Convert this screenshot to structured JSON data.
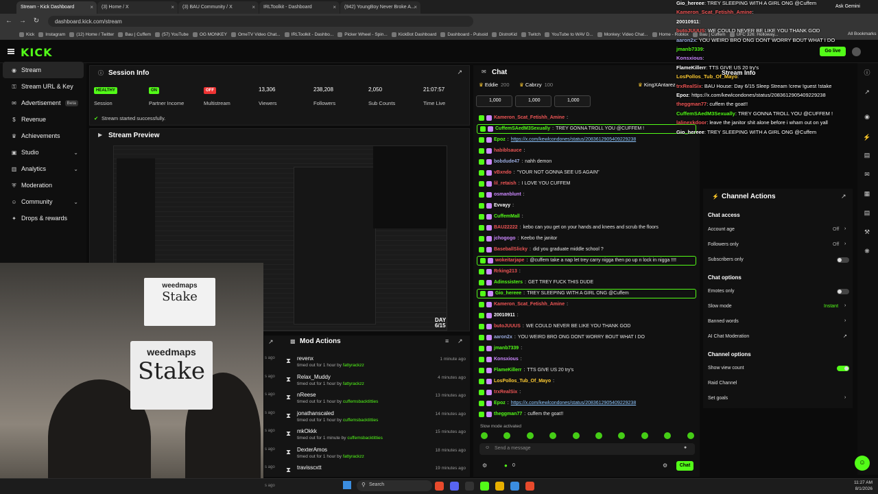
{
  "browser": {
    "tabs": [
      {
        "label": "Stream - Kick Dashboard",
        "active": true
      },
      {
        "label": "(3) Home / X"
      },
      {
        "label": "(3) BAU Community / X"
      },
      {
        "label": "IRLToolkit - Dashboard"
      },
      {
        "label": "(942) YoungBoy Never Broke A..."
      }
    ],
    "url": "dashboard.kick.com/stream",
    "ask_gemini": "Ask Gemini",
    "all_bookmarks": "All Bookmarks",
    "bookmarks": [
      "Kick",
      "Instagram",
      "(12) Home / Twitter",
      "Bau | Cuffem",
      "(57) YouTube",
      "OG MONKEY",
      "OmeTV Video Chat...",
      "IRLToolkit - Dashbo...",
      "Picker Wheel - Spin...",
      "KickBot Dashboard",
      "Dashboard - Pulsoid",
      "DistroKid",
      "Twitch",
      "YouTube to WAV D...",
      "Monkey: Video Chat...",
      "Home - Roblox",
      "Bau | Cuffem",
      "UFC 326: Holloway..."
    ]
  },
  "kick": {
    "logo": "KICK",
    "go_live": "Go live",
    "sidebar": [
      {
        "label": "Stream",
        "icon": "broadcast-icon",
        "active": true
      },
      {
        "label": "Stream URL & Key",
        "icon": "key-icon"
      },
      {
        "label": "Advertisement",
        "icon": "megaphone-icon",
        "badge": "Beta"
      },
      {
        "label": "Revenue",
        "icon": "dollar-icon"
      },
      {
        "label": "Achievements",
        "icon": "trophy-icon"
      },
      {
        "label": "Studio",
        "icon": "studio-icon",
        "chevron": true
      },
      {
        "label": "Analytics",
        "icon": "chart-icon",
        "chevron": true
      },
      {
        "label": "Moderation",
        "icon": "shield-icon"
      },
      {
        "label": "Community",
        "icon": "people-icon",
        "chevron": true
      },
      {
        "label": "Drops & rewards",
        "icon": "gift-icon"
      }
    ],
    "session": {
      "title": "Session Info",
      "status": "Stream started successfully.",
      "stats": [
        {
          "value": "HEALTHY",
          "label": "Session",
          "badge_color": "#53fc18"
        },
        {
          "value": "ON",
          "label": "Partner Income",
          "badge_color": "#53fc18"
        },
        {
          "value": "OFF",
          "label": "Multistream",
          "badge_color": "#e33"
        },
        {
          "value": "13,306",
          "label": "Viewers"
        },
        {
          "value": "238,208",
          "label": "Followers"
        },
        {
          "value": "2,050",
          "label": "Sub Counts"
        },
        {
          "value": "21:07:57",
          "label": "Time Live"
        }
      ]
    },
    "preview": {
      "title": "Stream Preview",
      "banner_top": "weedmaps",
      "banner_bottom": "Stake",
      "day_label": "DAY 6/15",
      "wm_small": "weedmaps",
      "stake_small": "Stake"
    },
    "mod_actions": {
      "title": "Mod Actions",
      "side_times": [
        "s ago",
        "s ago",
        "s ago",
        "s ago",
        "s ago",
        "s ago",
        "s ago",
        "s ago"
      ],
      "items": [
        {
          "name": "revenx",
          "desc": "timed out for 1 hour by",
          "by": "fattyrackzz",
          "time": "1 minute ago"
        },
        {
          "name": "Relax_Muddy",
          "desc": "timed out for 1 hour by",
          "by": "fattyrackzz",
          "time": "4 minutes ago"
        },
        {
          "name": "nReese",
          "desc": "timed out for 1 hour by",
          "by": "cuffemsbacktitties",
          "time": "13 minutes ago"
        },
        {
          "name": "jonathanscaled",
          "desc": "timed out for 1 hour by",
          "by": "cuffemsbacktitties",
          "time": "14 minutes ago"
        },
        {
          "name": "mkOkkk",
          "desc": "timed out for 1 minute by",
          "by": "cuffemsbacktitties",
          "time": "15 minutes ago"
        },
        {
          "name": "DexterAmos",
          "desc": "timed out for 1 hour by",
          "by": "fattyrackzz",
          "time": "18 minutes ago"
        },
        {
          "name": "travisscxtt",
          "desc": "",
          "by": "",
          "time": "19 minutes ago"
        }
      ]
    },
    "chat": {
      "title": "Chat",
      "pinned": [
        {
          "name": "Eddie",
          "val": "200"
        },
        {
          "name": "Cabrzy",
          "val": "100"
        },
        {
          "name": "KingXAntarez",
          "val": ""
        }
      ],
      "gifts": [
        "1,000",
        "1,000",
        "1,000"
      ],
      "messages": [
        {
          "user": "Kameron_Scat_Fetishh_Amine",
          "text": "",
          "color": "#e55"
        },
        {
          "user": "CuffemSAedM3Sexually",
          "text": "TREY GONNA TROLL YOU @CUFFEM !",
          "color": "#53fc18",
          "hl": true
        },
        {
          "user": "Epoz",
          "text": "https://x.com/kewlcondones/status/2083612905409229238",
          "color": "#53fc18",
          "link": true
        },
        {
          "user": "habiblsauce",
          "text": "",
          "color": "#e55"
        },
        {
          "user": "bobdude47",
          "text": "nahh demon",
          "color": "#9ad"
        },
        {
          "user": "vBxndo",
          "text": "\"YOUR NOT GONNA SEE US AGAIN\"",
          "color": "#e55"
        },
        {
          "user": "lil_retaish",
          "text": "I LOVE YOU CUFFEM",
          "color": "#e55"
        },
        {
          "user": "osmanblunt",
          "text": "",
          "color": "#c8f"
        },
        {
          "user": "Evvayy",
          "text": "",
          "color": "#fff"
        },
        {
          "user": "CuffemMall",
          "text": "",
          "color": "#53fc18"
        },
        {
          "user": "BAU22222",
          "text": "kebo can you get on your hands and knees and scrub the floors",
          "color": "#e55"
        },
        {
          "user": "jchogogo",
          "text": "Keebo the janitor",
          "color": "#c8f"
        },
        {
          "user": "BaseballSlicky",
          "text": "did you graduate middle school ?",
          "color": "#e55"
        },
        {
          "user": "wokeitarjape",
          "text": "@cuffem take a nap let trey carry nigga then po up n lock in nigga !!!!",
          "color": "#e55",
          "hl": true
        },
        {
          "user": "Rrking213",
          "text": "",
          "color": "#e55"
        },
        {
          "user": "Adinssisters",
          "text": "GET TREY FUCK THIS DUDE",
          "color": "#53fc18"
        },
        {
          "user": "Gio_hereee",
          "text": "TREY SLEEPING WITH A GIRL ONG @Cuffem",
          "color": "#53fc18",
          "hl": true
        },
        {
          "user": "Kameron_Scat_Fetishh_Amine",
          "text": "",
          "color": "#e55"
        },
        {
          "user": "20010911",
          "text": "",
          "color": "#fff"
        },
        {
          "user": "butoJUUUS",
          "text": "WE COULD NEVER BE LIKE YOU THANK GOD",
          "color": "#e55"
        },
        {
          "user": "aaron2x",
          "text": "YOU WEIRD BRO ONG DONT WORRY BOUT WHAT I DO",
          "color": "#9ad"
        },
        {
          "user": "jmanb7339",
          "text": "",
          "color": "#53fc18"
        },
        {
          "user": "Konsxious",
          "text": "",
          "color": "#c8f"
        },
        {
          "user": "FlameKillerr",
          "text": "TTS GIVE US 20 try's",
          "color": "#53fc18"
        },
        {
          "user": "LosPollos_Tub_Of_Mayo",
          "text": "",
          "color": "#fc3"
        },
        {
          "user": "trxRealSix",
          "text": "",
          "color": "#e55"
        },
        {
          "user": "Epoz",
          "text": "https://x.com/kewlcondones/status/2083612905409229238",
          "color": "#53fc18",
          "link": true
        },
        {
          "user": "theggman77",
          "text": "cuffem the goat!!",
          "color": "#53fc18"
        }
      ],
      "slow_mode": "Slow mode activated",
      "placeholder": "Send a message",
      "send_label": "Chat",
      "points": "0"
    },
    "stream_info_title": "Stream Info",
    "channel_actions": {
      "title": "Channel Actions",
      "chat_access": "Chat access",
      "account_age": "Account age",
      "account_age_val": "Off",
      "followers_only": "Followers only",
      "followers_only_val": "Off",
      "subscribers_only": "Subscribers only",
      "chat_options": "Chat options",
      "emotes_only": "Emotes only",
      "slow_mode": "Slow mode",
      "slow_mode_val": "Instant",
      "banned_words": "Banned words",
      "ai_moderation": "AI Chat Moderation",
      "channel_options": "Channel options",
      "show_view_count": "Show view count",
      "raid_channel": "Raid Channel",
      "set_goals": "Set goals"
    }
  },
  "overlay": [
    {
      "user": "Gio_hereee",
      "text": "TREY SLEEPING WITH A GIRL ONG @Cuffem",
      "color": "#fff"
    },
    {
      "user": "Kameron_Scat_Fetishh_Amine",
      "text": "",
      "color": "#e55"
    },
    {
      "user": "20010911",
      "text": "",
      "color": "#fff"
    },
    {
      "user": "butoJUUUS",
      "text": "WE COULD NEVER BE LIKE YOU THANK GOD",
      "color": "#e55"
    },
    {
      "user": "aaron2x",
      "text": "YOU WEIRD BRO ONG DONT WORRY BOUT WHAT I DO",
      "color": "#9ad"
    },
    {
      "user": "jmanb7339",
      "text": "",
      "color": "#53fc18"
    },
    {
      "user": "Konsxious",
      "text": "",
      "color": "#c8f"
    },
    {
      "user": "FlameKillerr",
      "text": "TTS GIVE US 20 try's",
      "color": "#fff"
    },
    {
      "user": "LosPollos_Tub_Of_Mayo",
      "text": "",
      "color": "#fc3"
    },
    {
      "user": "trxRealSix",
      "text": "BAU House: Day 6/15 Sleep Stream !crew !guest !stake",
      "color": "#e55"
    },
    {
      "user": "Epoz",
      "text": "https://x.com/kewlcondones/status/2083612905409229238",
      "color": "#fff"
    },
    {
      "user": "theggman77",
      "text": "cuffem the goat!!",
      "color": "#e55"
    },
    {
      "user": "CuffemSAedM3Sexually",
      "text": "TREY GONNA TROLL YOU @CUFFEM !",
      "color": "#53fc18"
    },
    {
      "user": "lalinexkdoor",
      "text": "leave the janitor shit alone before i wham out on yall",
      "color": "#e55"
    },
    {
      "user": "Gio_hereee",
      "text": "TREY SLEEPING WITH A GIRL ONG @Cuffem",
      "color": "#fff"
    }
  ],
  "taskbar": {
    "search": "Search",
    "time": "11:27 AM",
    "date": "8/1/2026"
  }
}
